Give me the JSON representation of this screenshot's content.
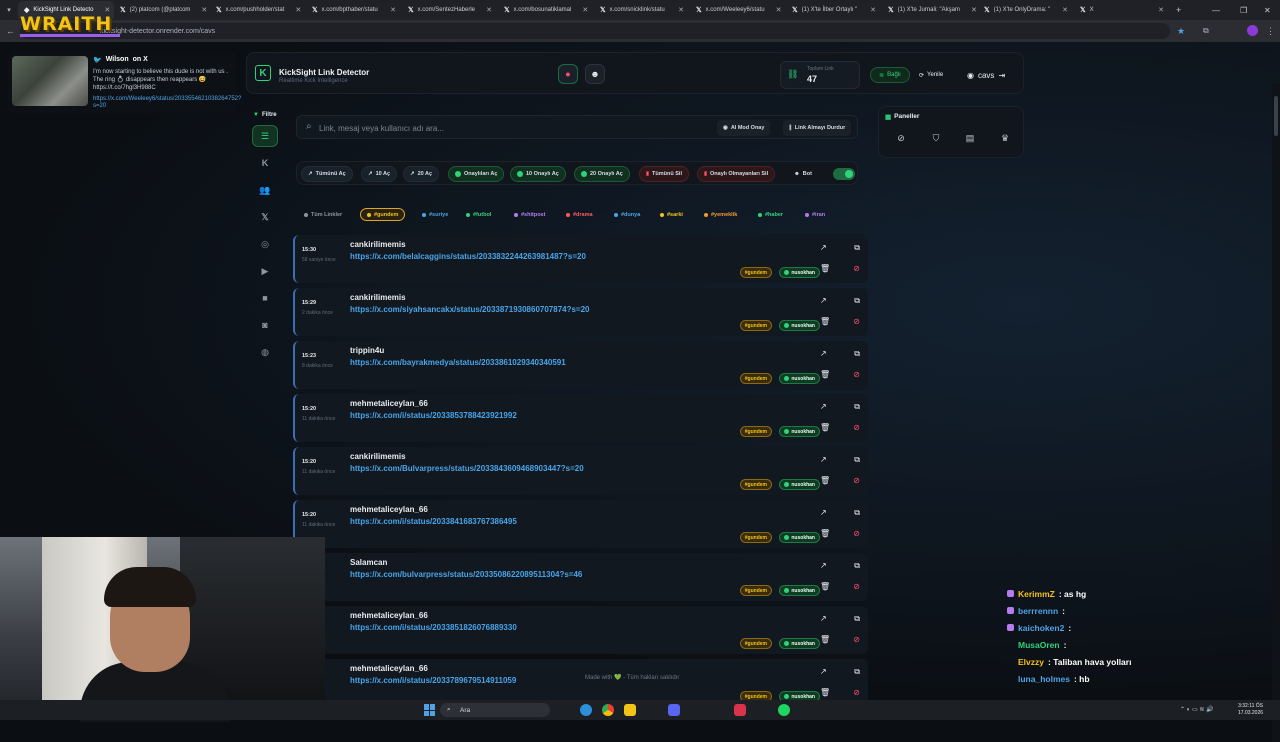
{
  "browser": {
    "tabs": [
      {
        "label": "KickSight Link Detecto",
        "active": true
      },
      {
        "label": "(2) platcom (@platcom",
        "active": false
      },
      {
        "label": "x.com/pushholder/stat",
        "active": false
      },
      {
        "label": "x.com/bpthaber/statu",
        "active": false
      },
      {
        "label": "x.com/SentezHaberle",
        "active": false
      },
      {
        "label": "x.com/bosunatiklamal",
        "active": false
      },
      {
        "label": "x.com/snicklink/statu",
        "active": false
      },
      {
        "label": "x.com/Weeleey6/statu",
        "active": false
      },
      {
        "label": "(1) X'te İlber Ortaylı \"",
        "active": false
      },
      {
        "label": "(1) X'te Jurnali: \"Akşam",
        "active": false
      },
      {
        "label": "(1) X'te OnlyDrama: \"",
        "active": false
      },
      {
        "label": "X",
        "active": false
      }
    ],
    "url": "kicksight-detector.onrender.com/cavs"
  },
  "overlay": {
    "brand": "WRAITH"
  },
  "tweet": {
    "author": "Wilson",
    "suffix": "on X",
    "text": "I'm now starting to believe this dude is not with us . The ring 💍 disappears then reappears 😅 https://t.co/7hgl3H988C",
    "link": "https://x.com/Weeleey6/status/2033554621038264752?s=20"
  },
  "header": {
    "title": "KickSight Link Detector",
    "subtitle": "Realtime Kick Intelligence",
    "stat_label": "Toplam Link",
    "stat_value": "47",
    "connected": "Bağlı",
    "refresh": "Yenile",
    "user": "cavs"
  },
  "filter": {
    "label": "Filtre"
  },
  "search": {
    "placeholder": "Link, mesaj veya kullanıcı adı ara...",
    "ai_mode": "AI Mod Onay",
    "stop": "Link Almayı Durdur"
  },
  "actions": {
    "open_all": "Tümünü Aç",
    "open10": "10 Aç",
    "open20": "20 Aç",
    "open_approved": "Onaylıları Aç",
    "open10_approved": "10 Onaylı Aç",
    "open20_approved": "20 Onaylı Aç",
    "delete_all": "Tümünü Sil",
    "delete_unapproved": "Onaylı Olmayanları Sil",
    "bot": "Bot"
  },
  "tags": [
    {
      "label": "Tüm Linkler",
      "color": "#8d97a3"
    },
    {
      "label": "#gundem",
      "color": "#f3c316"
    },
    {
      "label": "#suriye",
      "color": "#4ea3e6"
    },
    {
      "label": "#futbol",
      "color": "#2fd37a"
    },
    {
      "label": "#shitpost",
      "color": "#b57cf0"
    },
    {
      "label": "#drama",
      "color": "#ff5a5a"
    },
    {
      "label": "#dunya",
      "color": "#4ea3e6"
    },
    {
      "label": "#sarki",
      "color": "#f3c316"
    },
    {
      "label": "#yemeklik",
      "color": "#f39a2f"
    },
    {
      "label": "#haber",
      "color": "#2fd37a"
    },
    {
      "label": "#iran",
      "color": "#b57cf0"
    }
  ],
  "links": [
    {
      "time": "15:30",
      "ago": "58 saniye önce",
      "user": "cankirilimemis",
      "url": "https://x.com/belalcaggins/status/2033832244263981487?s=20",
      "tag": "#gundem",
      "approver": "nusokhan"
    },
    {
      "time": "15:29",
      "ago": "2 dakika önce",
      "user": "cankirilimemis",
      "url": "https://x.com/siyahsancakx/status/2033871930860707874?s=20",
      "tag": "#gundem",
      "approver": "nusokhan"
    },
    {
      "time": "15:23",
      "ago": "8 dakika önce",
      "user": "trippin4u",
      "url": "https://x.com/bayrakmedya/status/2033861029340340591",
      "tag": "#gundem",
      "approver": "nusokhan"
    },
    {
      "time": "15:20",
      "ago": "11 dakika önce",
      "user": "mehmetaliceylan_66",
      "url": "https://x.com/i/status/2033853788423921992",
      "tag": "#gundem",
      "approver": "nusokhan"
    },
    {
      "time": "15:20",
      "ago": "11 dakika önce",
      "user": "cankirilimemis",
      "url": "https://x.com/Bulvarpress/status/2033843609468903447?s=20",
      "tag": "#gundem",
      "approver": "nusokhan"
    },
    {
      "time": "15:20",
      "ago": "11 dakika önce",
      "user": "mehmetaliceylan_66",
      "url": "https://x.com/i/status/2033841683767386495",
      "tag": "#gundem",
      "approver": "nusokhan"
    },
    {
      "time": "",
      "ago": "",
      "user": "Salamcan",
      "url": "https://x.com/bulvarpress/status/2033508622089511304?s=46",
      "tag": "#gundem",
      "approver": "nusokhan"
    },
    {
      "time": "",
      "ago": "",
      "user": "mehmetaliceylan_66",
      "url": "https://x.com/i/status/2033851826076889330",
      "tag": "#gundem",
      "approver": "nusokhan"
    },
    {
      "time": "",
      "ago": "",
      "user": "mehmetaliceylan_66",
      "url": "https://x.com/i/status/2033789679514911059",
      "tag": "#gundem",
      "approver": "nusokhan"
    }
  ],
  "panels": {
    "label": "Paneller"
  },
  "footer": {
    "made_with": "Made with 💚 - Tüm hakları saklıdır"
  },
  "chat": [
    {
      "user": "KerimmZ",
      "msg": ": as hg",
      "color": "#f3c316"
    },
    {
      "user": "berrrennn",
      "msg": ":",
      "color": "#4ea3e6"
    },
    {
      "user": "kaichoken2",
      "msg": ":",
      "color": "#4ea3e6"
    },
    {
      "user": "MusaOren",
      "msg": ":",
      "color": "#2fd37a"
    },
    {
      "user": "Elvzzy",
      "msg": ": Taliban hava yolları",
      "color": "#f3c316"
    },
    {
      "user": "luna_holmes",
      "msg": ": hb",
      "color": "#4ea3e6"
    }
  ],
  "taskbar": {
    "search": "Ara",
    "time": "3:32:11 ÖS",
    "date": "17.03.2026"
  }
}
